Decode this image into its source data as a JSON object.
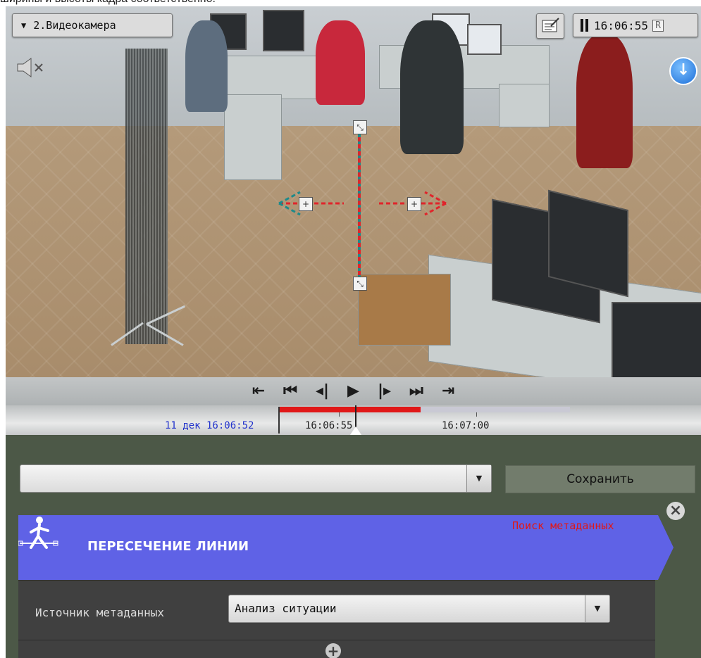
{
  "top_caption": "ширины и высоты кадра соответственно.",
  "camera": {
    "title": "2.Видеокамера",
    "time": "16:06:55",
    "rec_flag": "R"
  },
  "playback": {
    "buttons": [
      "⇤",
      "⏮",
      "◂|",
      "▶",
      "|▸",
      "⏭",
      "⇥"
    ]
  },
  "timeline": {
    "start_label": "11 дек 16:06:52",
    "label_1": "16:06:55",
    "label_2": "16:07:00"
  },
  "search_panel": {
    "combo_value": "",
    "save_label": "Сохранить"
  },
  "rule": {
    "title": "ПЕРЕСЕЧЕНИЕ ЛИНИИ",
    "meta_search": "Поиск метаданных",
    "source_label": "Источник метаданных",
    "source_value": "Анализ ситуации"
  },
  "colors": {
    "rule_header": "#5f62e6",
    "panel_bg": "#4c5847",
    "timeline_red": "#e01818",
    "meta_search_red": "#e01818"
  },
  "icons": [
    "sort-down-icon",
    "pause-icon",
    "note-icon",
    "mute-icon",
    "download-icon",
    "close-icon",
    "add-icon",
    "line-crossing-icon"
  ]
}
